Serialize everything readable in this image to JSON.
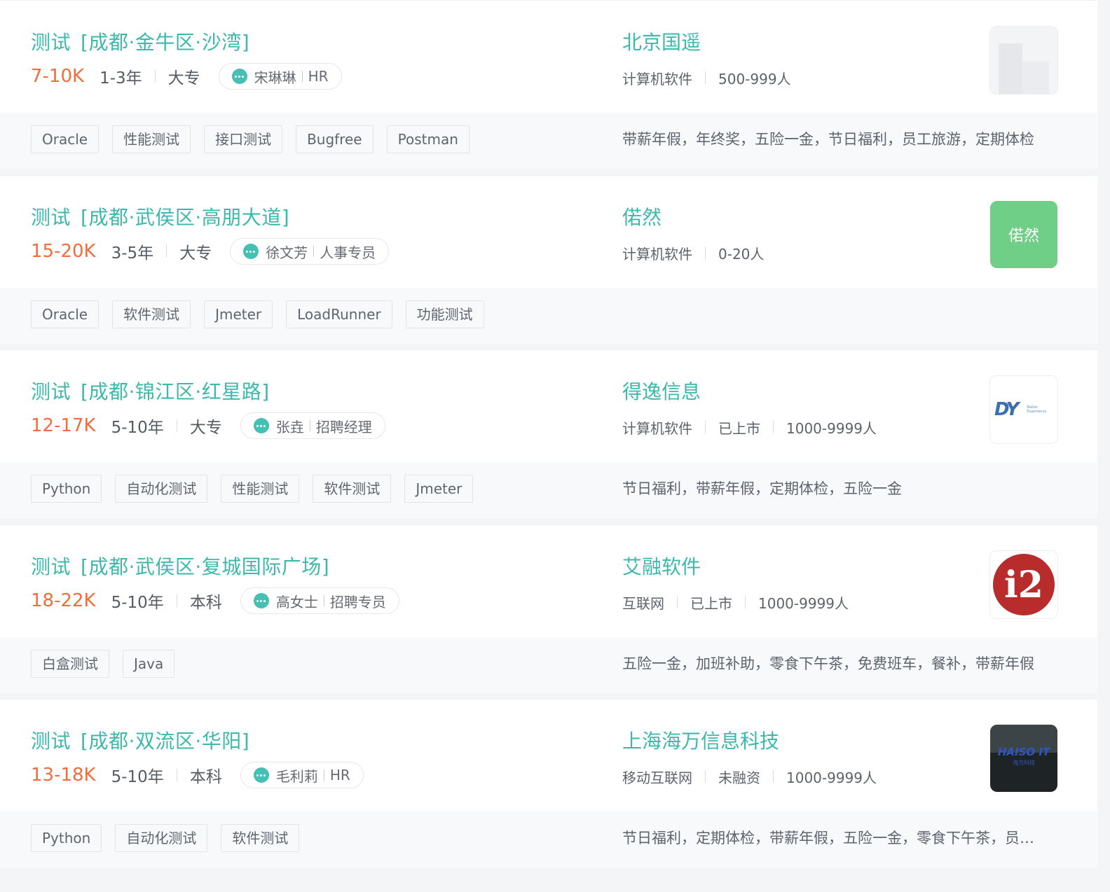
{
  "jobs": [
    {
      "title": "测试",
      "area": "[成都·金牛区·沙湾]",
      "salary": "7-10K",
      "experience": "1-3年",
      "education": "大专",
      "recruiter_name": "宋琳琳",
      "recruiter_role": "HR",
      "company": "北京国遥",
      "company_info": [
        "计算机软件",
        "500-999人"
      ],
      "logo_type": "placeholder",
      "tags": [
        "Oracle",
        "性能测试",
        "接口测试",
        "Bugfree",
        "Postman"
      ],
      "benefits": "带薪年假，年终奖，五险一金，节日福利，员工旅游，定期体检"
    },
    {
      "title": "测试",
      "area": "[成都·武侯区·高朋大道]",
      "salary": "15-20K",
      "experience": "3-5年",
      "education": "大专",
      "recruiter_name": "徐文芳",
      "recruiter_role": "人事专员",
      "company": "偌然",
      "company_info": [
        "计算机软件",
        "0-20人"
      ],
      "logo_type": "text",
      "logo_text": "偌然",
      "tags": [
        "Oracle",
        "软件测试",
        "Jmeter",
        "LoadRunner",
        "功能测试"
      ],
      "benefits": ""
    },
    {
      "title": "测试",
      "area": "[成都·锦江区·红星路]",
      "salary": "12-17K",
      "experience": "5-10年",
      "education": "大专",
      "recruiter_name": "张垚",
      "recruiter_role": "招聘经理",
      "company": "得逸信息",
      "company_info": [
        "计算机软件",
        "已上市",
        "1000-9999人"
      ],
      "logo_type": "dy",
      "logo_text": "DY",
      "logo_sub": "Better Experience",
      "tags": [
        "Python",
        "自动化测试",
        "性能测试",
        "软件测试",
        "Jmeter"
      ],
      "benefits": "节日福利，带薪年假，定期体检，五险一金"
    },
    {
      "title": "测试",
      "area": "[成都·武侯区·复城国际广场]",
      "salary": "18-22K",
      "experience": "5-10年",
      "education": "本科",
      "recruiter_name": "高女士",
      "recruiter_role": "招聘专员",
      "company": "艾融软件",
      "company_info": [
        "互联网",
        "已上市",
        "1000-9999人"
      ],
      "logo_type": "i2",
      "logo_text": "i2",
      "tags": [
        "白盒测试",
        "Java"
      ],
      "benefits": "五险一金，加班补助，零食下午茶，免费班车，餐补，带薪年假"
    },
    {
      "title": "测试",
      "area": "[成都·双流区·华阳]",
      "salary": "13-18K",
      "experience": "5-10年",
      "education": "本科",
      "recruiter_name": "毛利莉",
      "recruiter_role": "HR",
      "company": "上海海万信息科技",
      "company_info": [
        "移动互联网",
        "未融资",
        "1000-9999人"
      ],
      "logo_type": "haiso",
      "logo_text": "HAISO IT",
      "logo_sub": "海万科技",
      "tags": [
        "Python",
        "自动化测试",
        "软件测试"
      ],
      "benefits": "节日福利，定期体检，带薪年假，五险一金，零食下午茶，员工旅游"
    }
  ]
}
